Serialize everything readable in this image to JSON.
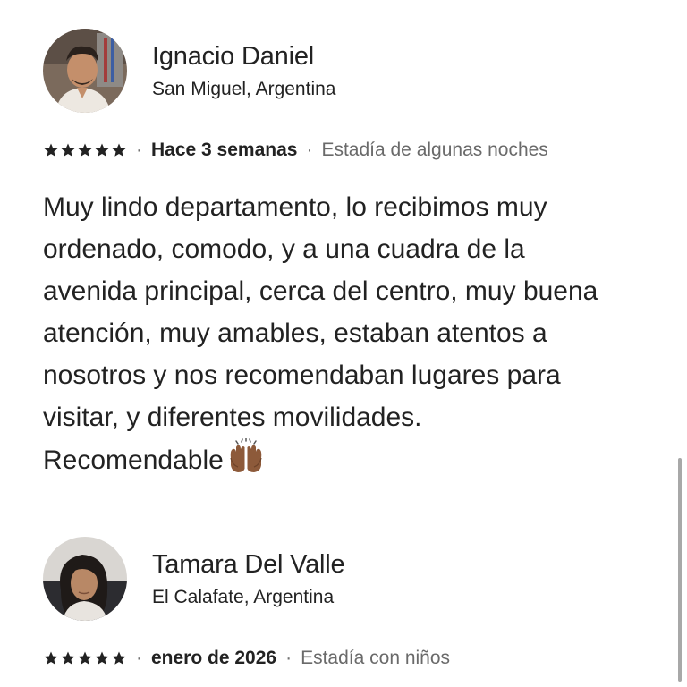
{
  "reviews": [
    {
      "name": "Ignacio Daniel",
      "location": "San Miguel, Argentina",
      "rating": 5,
      "date": "Hace 3 semanas",
      "stay": "Estadía de algunas noches",
      "separator": "·",
      "text": "Muy lindo departamento, lo recibimos muy\nordenado, comodo, y a una cuadra de la\navenida principal, cerca del centro, muy buena\natención, muy amables, estaban atentos a\nnosotros y nos recomendaban lugares para\nvisitar, y diferentes movilidades.\nRecomendable",
      "emoji_icon": "raising-hands-emoji-icon"
    },
    {
      "name": "Tamara Del Valle",
      "location": "El Calafate, Argentina",
      "rating": 5,
      "date": "enero de 2026",
      "stay": "Estadía con niños",
      "separator": "·"
    }
  ],
  "colors": {
    "text_primary": "#222222",
    "text_secondary": "#6a6a6a",
    "scrollbar": "#a8a8a8"
  }
}
